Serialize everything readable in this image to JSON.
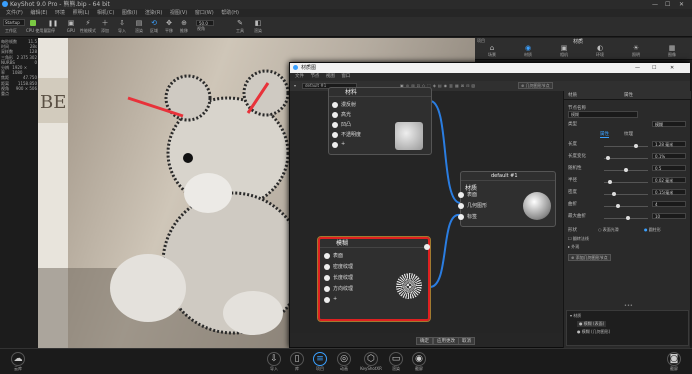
{
  "app": {
    "title": "KeyShot 9.0 Pro - 熊熊.bip - 64 bit"
  },
  "menu": [
    "文件(F)",
    "编辑(E)",
    "环境",
    "照明(L)",
    "相机(C)",
    "图像(I)",
    "渲染(R)",
    "视图(V)",
    "窗口(W)",
    "帮助(H)"
  ],
  "toolbar": {
    "workspace_value": "Startup",
    "workspace_label": "工作区",
    "cpu_label": "CPU 使用量",
    "pause_label": "暂停",
    "gpu_label": "GPU",
    "items": [
      "性能模式",
      "添加",
      "导入",
      "渲染",
      "区域",
      "平移",
      "推移",
      "视角",
      "工具",
      "渲染"
    ],
    "zoom_value": "50.0"
  },
  "left_stats": [
    {
      "k": "每秒帧数",
      "v": "11.5"
    },
    {
      "k": "时间",
      "v": "28s"
    },
    {
      "k": "采样数",
      "v": "128"
    },
    {
      "k": "三角形",
      "v": "2 375 302"
    },
    {
      "k": "NURBS",
      "v": "0"
    },
    {
      "k": "分辨率",
      "v": "1920 × 1080"
    },
    {
      "k": "焦距",
      "v": "47.750"
    },
    {
      "k": "距离",
      "v": "1158.850"
    },
    {
      "k": "视角",
      "v": "900 × 506"
    },
    {
      "k": "重点",
      "v": ""
    }
  ],
  "right_panel": {
    "header": "项目",
    "title": "材质",
    "tabs": [
      "场景",
      "材质",
      "相机",
      "环境",
      "照明",
      "图像"
    ]
  },
  "dialog": {
    "title": "材质图",
    "menu": [
      "文件",
      "节点",
      "视图",
      "窗口"
    ],
    "material_select": "default #1",
    "toolbar_button": "几何图形节点",
    "nodes": {
      "top": {
        "title": "材料",
        "ports": [
          "漫反射",
          "高光",
          "凹凸",
          "不透明度",
          "+"
        ]
      },
      "material": {
        "title": "default #1",
        "sub": "材质",
        "ports": [
          "表面",
          "几何图形",
          "标签"
        ]
      },
      "fuzz": {
        "title": "模糊",
        "ports": [
          "表面",
          "密度纹理",
          "长度纹理",
          "方向纹理",
          "+"
        ]
      }
    },
    "props": {
      "header_left": "材质",
      "header_right": "属性",
      "name_label": "节点名称",
      "name_value": "模糊",
      "type_label": "类型",
      "type_value": "模糊",
      "tabs": [
        "属性",
        "纹理"
      ],
      "fields": [
        {
          "label": "长度",
          "value": "1.28 毫米"
        },
        {
          "label": "长度变化",
          "value": "0.1%"
        },
        {
          "label": "随机性",
          "value": "0.5"
        },
        {
          "label": "半径",
          "value": "0.02 毫米"
        },
        {
          "label": "密度",
          "value": "0.15/毫米"
        },
        {
          "label": "曲折",
          "value": "4"
        },
        {
          "label": "最大曲折",
          "value": "10"
        }
      ],
      "shape_label": "形状",
      "shape_opt1": "表面光滑",
      "shape_opt2": "圆柱形",
      "flip_label": "翻转法线",
      "section_label": "外观",
      "gen_button": "添加几何图形节点",
      "tree_header": "材质",
      "tree_items": [
        "模糊 (表面)",
        "模糊 (几何图形)"
      ]
    },
    "bottom_buttons": [
      "确定",
      "应用更改",
      "取消"
    ]
  },
  "bottom_bar": {
    "left": "云库",
    "items": [
      "导入",
      "库",
      "项目",
      "动画",
      "KeyShotXR",
      "渲染",
      "截屏"
    ],
    "right": "截屏"
  },
  "colors": {
    "accent": "#3aa0ff",
    "highlight": "#e02020",
    "arrow": "#e8323a",
    "wire": "#2a7de1"
  }
}
